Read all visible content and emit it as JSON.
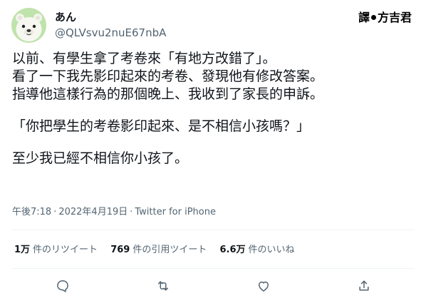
{
  "user": {
    "display_name": "あん",
    "handle": "@QLVsvu2nuE67nbA"
  },
  "watermark": {
    "left": "譯",
    "right": "方吉君"
  },
  "tweet": {
    "lines": [
      "以前、有學生拿了考卷來「有地方改錯了」。",
      "看了一下我先影印起來的考卷、發現他有修改答案。",
      "指導他這樣行為的那個晚上、我收到了家長的申訴。",
      "",
      "「你把學生的考卷影印起來、是不相信小孩嗎？」",
      "",
      "至少我已經不相信你小孩了。"
    ]
  },
  "meta": {
    "time": "午後7:18",
    "separator": "·",
    "date": "2022年4月19日",
    "client": "Twitter for iPhone"
  },
  "stats": {
    "retweets_count": "1万",
    "retweets_label": "件のリツイート",
    "quotes_count": "769",
    "quotes_label": "件の引用ツイート",
    "likes_count": "6.6万",
    "likes_label": "件のいいね"
  },
  "actions": {
    "reply_icon": "reply-icon",
    "retweet_icon": "retweet-icon",
    "like_icon": "like-icon",
    "share_icon": "share-icon"
  },
  "colors": {
    "text": "#0f1419",
    "secondary": "#536471",
    "divider": "#eff3f4",
    "avatar_bg": "#bfe3ab"
  }
}
